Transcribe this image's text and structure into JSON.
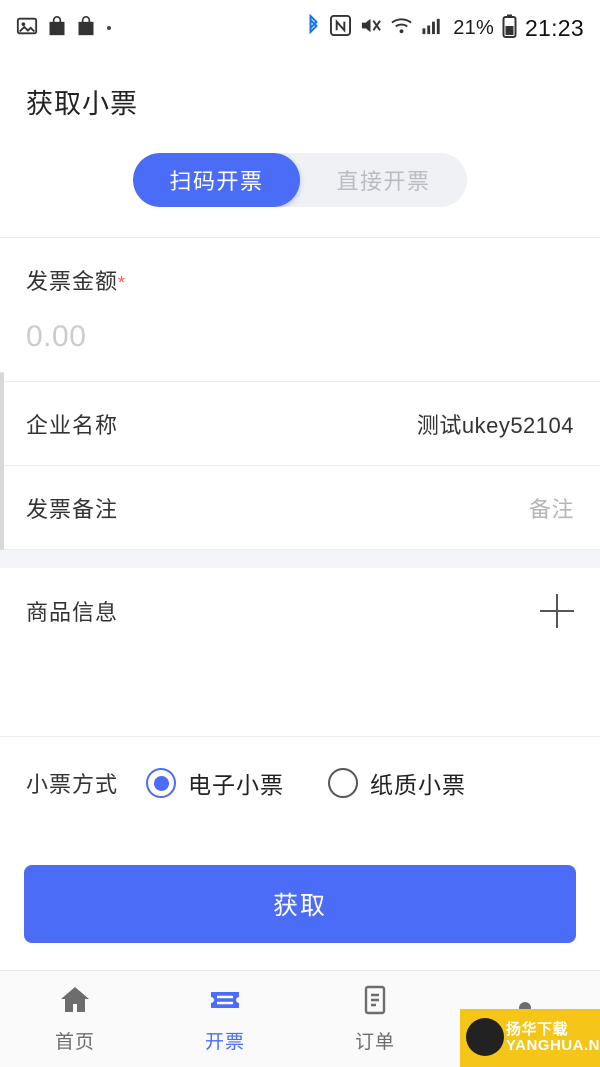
{
  "status_bar": {
    "icons_left": [
      "image-icon",
      "shopping-bag-icon",
      "shopping-bag-icon",
      "dot-icon"
    ],
    "icons_right": [
      "bluetooth-icon",
      "nfc-icon",
      "mute-icon",
      "wifi-icon",
      "signal-icon"
    ],
    "battery_text": "21%",
    "battery_icon": "battery-icon",
    "clock": "21:23"
  },
  "header": {
    "title": "获取小票"
  },
  "tabs": [
    {
      "label": "扫码开票",
      "active": true
    },
    {
      "label": "直接开票",
      "active": false
    }
  ],
  "form": {
    "amount": {
      "label": "发票金额",
      "required_mark": "*",
      "placeholder": "0.00",
      "value": ""
    },
    "company": {
      "label": "企业名称",
      "value": "测试ukey52104"
    },
    "remark": {
      "label": "发票备注",
      "placeholder": "备注",
      "value": ""
    },
    "goods": {
      "label": "商品信息",
      "add_icon": "plus-icon"
    },
    "receipt_type": {
      "label": "小票方式",
      "options": [
        {
          "label": "电子小票",
          "selected": true
        },
        {
          "label": "纸质小票",
          "selected": false
        }
      ]
    }
  },
  "submit": {
    "label": "获取"
  },
  "bottom_nav": [
    {
      "label": "首页",
      "icon": "home-icon",
      "active": false
    },
    {
      "label": "开票",
      "icon": "ticket-icon",
      "active": true
    },
    {
      "label": "订单",
      "icon": "order-list-icon",
      "active": false
    },
    {
      "label": "",
      "icon": "user-icon",
      "active": false
    }
  ],
  "watermark": {
    "line1": "扬华下载",
    "line2": "YANGHUA.NET"
  },
  "colors": {
    "accent": "#4a6cf7",
    "required": "#ff5a4d",
    "divider": "#ececec",
    "section_gap": "#f4f5f9",
    "watermark_bg": "#f5c518"
  }
}
